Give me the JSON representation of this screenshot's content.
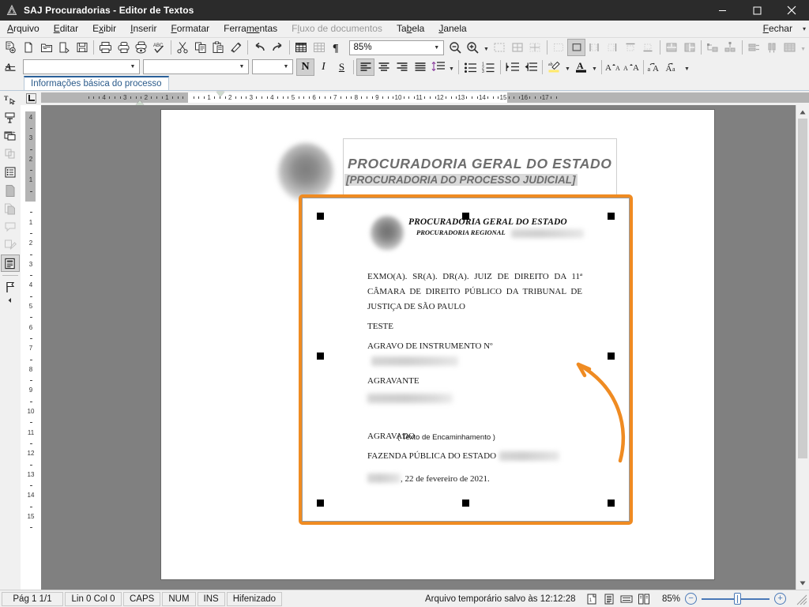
{
  "window": {
    "title": "SAJ Procuradorias - Editor de Textos",
    "app_icon": "saj-logo-icon",
    "minimize_label": "─",
    "maximize_label": "☐",
    "close_label": "✕"
  },
  "menubar": {
    "items": [
      {
        "label": "Arquivo",
        "accel": "A",
        "disabled": false
      },
      {
        "label": "Editar",
        "accel": "E",
        "disabled": false
      },
      {
        "label": "Exibir",
        "accel": "x",
        "disabled": false
      },
      {
        "label": "Inserir",
        "accel": "I",
        "disabled": false
      },
      {
        "label": "Formatar",
        "accel": "F",
        "disabled": false
      },
      {
        "label": "Ferramentas",
        "accel": "me",
        "disabled": false
      },
      {
        "label": "Fluxo de documentos",
        "accel": "l",
        "disabled": true
      },
      {
        "label": "Tabela",
        "accel": "b",
        "disabled": false
      },
      {
        "label": "Janela",
        "accel": "J",
        "disabled": false
      }
    ],
    "right_label": "Fechar",
    "right_caret": "▾"
  },
  "toolbar_standard": {
    "zoom_value": "85%",
    "buttons": [
      {
        "name": "new-document-icon",
        "disabled": false
      },
      {
        "name": "blank-page-icon",
        "disabled": false
      },
      {
        "name": "open-folder-icon",
        "disabled": false
      },
      {
        "name": "close-document-icon",
        "disabled": false
      },
      {
        "name": "save-icon",
        "disabled": false
      },
      {
        "name": "print-icon",
        "disabled": false
      },
      {
        "name": "print-setup-icon",
        "disabled": false
      },
      {
        "name": "print-preview-icon",
        "disabled": false
      },
      {
        "name": "spellcheck-icon",
        "disabled": false
      },
      {
        "name": "cut-icon",
        "disabled": false
      },
      {
        "name": "copy-icon",
        "disabled": false
      },
      {
        "name": "paste-icon",
        "disabled": false
      },
      {
        "name": "format-painter-icon",
        "disabled": false
      },
      {
        "name": "undo-icon",
        "disabled": false
      },
      {
        "name": "redo-icon",
        "disabled": false
      },
      {
        "name": "insert-table-icon",
        "disabled": false
      },
      {
        "name": "table-grid-icon",
        "disabled": true
      },
      {
        "name": "formatting-marks-icon",
        "disabled": false
      },
      {
        "name": "zoom-out-icon",
        "disabled": false
      },
      {
        "name": "zoom-in-icon",
        "disabled": false
      },
      {
        "name": "select-table-icon",
        "disabled": true
      },
      {
        "name": "table-borders-all-icon",
        "disabled": true
      },
      {
        "name": "table-borders-inner-icon",
        "disabled": true
      },
      {
        "name": "border-none-icon",
        "disabled": true
      },
      {
        "name": "border-box-icon",
        "disabled": false
      },
      {
        "name": "border-left-right-icon",
        "disabled": true
      },
      {
        "name": "border-vertical-icon",
        "disabled": true
      },
      {
        "name": "border-top-icon",
        "disabled": true
      },
      {
        "name": "border-bottom-icon",
        "disabled": true
      },
      {
        "name": "merge-cells-icon",
        "disabled": true
      },
      {
        "name": "split-cells-icon",
        "disabled": true
      },
      {
        "name": "insert-row-icon",
        "disabled": true
      },
      {
        "name": "insert-column-icon",
        "disabled": true
      },
      {
        "name": "distribute-rows-icon",
        "disabled": true
      },
      {
        "name": "distribute-columns-icon",
        "disabled": true
      },
      {
        "name": "table-shading-icon",
        "disabled": true
      }
    ]
  },
  "toolbar_format": {
    "style_value": "",
    "style_placeholder": "",
    "font_value": "",
    "font_placeholder": "",
    "size_value": "",
    "size_placeholder": "",
    "bold_label": "N",
    "italic_label": "I",
    "underline_label": "S",
    "bold_active": true,
    "align_left_active": true,
    "buttons": [
      {
        "name": "font-color-underline-icon",
        "disabled": false
      },
      {
        "name": "align-left-icon",
        "disabled": false
      },
      {
        "name": "align-center-icon",
        "disabled": false
      },
      {
        "name": "align-right-icon",
        "disabled": false
      },
      {
        "name": "align-justify-icon",
        "disabled": false
      },
      {
        "name": "line-spacing-icon",
        "disabled": false
      },
      {
        "name": "bullet-list-icon",
        "disabled": false
      },
      {
        "name": "numbered-list-icon",
        "disabled": false
      },
      {
        "name": "increase-indent-icon",
        "disabled": false
      },
      {
        "name": "decrease-indent-icon",
        "disabled": false
      },
      {
        "name": "highlight-color-icon",
        "disabled": false
      },
      {
        "name": "font-color-icon",
        "disabled": false
      },
      {
        "name": "grow-font-icon",
        "disabled": false
      },
      {
        "name": "shrink-font-icon",
        "disabled": false
      },
      {
        "name": "uppercase-icon",
        "disabled": false
      },
      {
        "name": "lowercase-icon",
        "disabled": false
      }
    ]
  },
  "vertical_toolbar": {
    "buttons": [
      {
        "name": "text-cursor-icon",
        "disabled": false
      },
      {
        "name": "text-frame-icon",
        "disabled": false
      },
      {
        "name": "insert-field-icon",
        "disabled": false
      },
      {
        "name": "copy-field-icon",
        "disabled": true
      },
      {
        "name": "list-fields-icon",
        "disabled": false
      },
      {
        "name": "page-icon",
        "disabled": false
      },
      {
        "name": "duplicate-page-icon",
        "disabled": true
      },
      {
        "name": "comment-icon",
        "disabled": true
      },
      {
        "name": "edit-signature-icon",
        "disabled": true
      },
      {
        "name": "print-document-icon",
        "disabled": false
      },
      {
        "name": "bookmark-flag-icon",
        "disabled": false
      }
    ]
  },
  "document_tab": {
    "label": "Informações básica do processo"
  },
  "ruler": {
    "unit": "cm",
    "h_labels": [
      "4",
      "3",
      "2",
      "1",
      "1",
      "2",
      "3",
      "4",
      "5",
      "6",
      "7",
      "8",
      "9",
      "10",
      "11",
      "12",
      "13",
      "14",
      "15",
      "16",
      "17"
    ],
    "v_labels": [
      "4",
      "3",
      "2",
      "1",
      "1",
      "2",
      "3",
      "4",
      "5",
      "6",
      "7",
      "8",
      "9",
      "10",
      "11",
      "12",
      "13",
      "14",
      "15"
    ],
    "tab_stop_icon": "left-tab-stop-icon"
  },
  "document": {
    "header": {
      "logo_icon": "coat-of-arms-blurred-icon",
      "line1": "PROCURADORIA GERAL DO ESTADO",
      "line2": "[PROCURADORIA DO PROCESSO JUDICIAL]"
    },
    "embedded_object": {
      "selected": true,
      "selection_color": "#ef8b22",
      "handles": 8,
      "logo_icon": "coat-of-arms-blurred-icon",
      "title": "PROCURADORIA GERAL DO ESTADO",
      "subtitle": "PROCURADORIA REGIONAL",
      "subtitle_redacted": true,
      "paragraphs": [
        {
          "text": "EXMO(A). SR(A). DR(A). JUIZ DE DIREITO DA 11ª CÂMARA DE DIREITO PÚBLICO DA TRIBUNAL DE JUSTIÇA DE SÃO PAULO",
          "style": "justify"
        },
        {
          "text": "TESTE",
          "style": "plain"
        },
        {
          "text": "AGRAVO DE INSTRUMENTO Nº",
          "style": "plain",
          "redacted_after": true
        },
        {
          "text": "AGRAVANTE",
          "style": "plain"
        },
        {
          "text": "",
          "style": "redacted-line"
        },
        {
          "text": "AGRAVADO",
          "style": "plain"
        },
        {
          "text": "FAZENDA PÚBLICA DO ESTADO",
          "style": "plain",
          "redacted_after": true
        }
      ],
      "encaminhamento": "( Texto de Encaminhamento )",
      "date_line": ", 22 de fevereiro de 2021.",
      "date_redacted_prefix": true
    }
  },
  "annotation": {
    "arrow_color": "#ef8b22",
    "name": "callout-arrow"
  },
  "statusbar": {
    "page": "Pág 1    1/1",
    "line_col": "Lin 0  Col 0",
    "caps": "CAPS",
    "num": "NUM",
    "ins": "INS",
    "hyphen": "Hifenizado",
    "save_message": "Arquivo temporário salvo às 12:12:28",
    "view_icons": [
      {
        "name": "print-layout-view-icon"
      },
      {
        "name": "reading-view-icon"
      },
      {
        "name": "web-layout-view-icon"
      },
      {
        "name": "two-page-view-icon"
      }
    ],
    "zoom_level": "85%",
    "zoom_out_label": "−",
    "zoom_in_label": "+"
  }
}
